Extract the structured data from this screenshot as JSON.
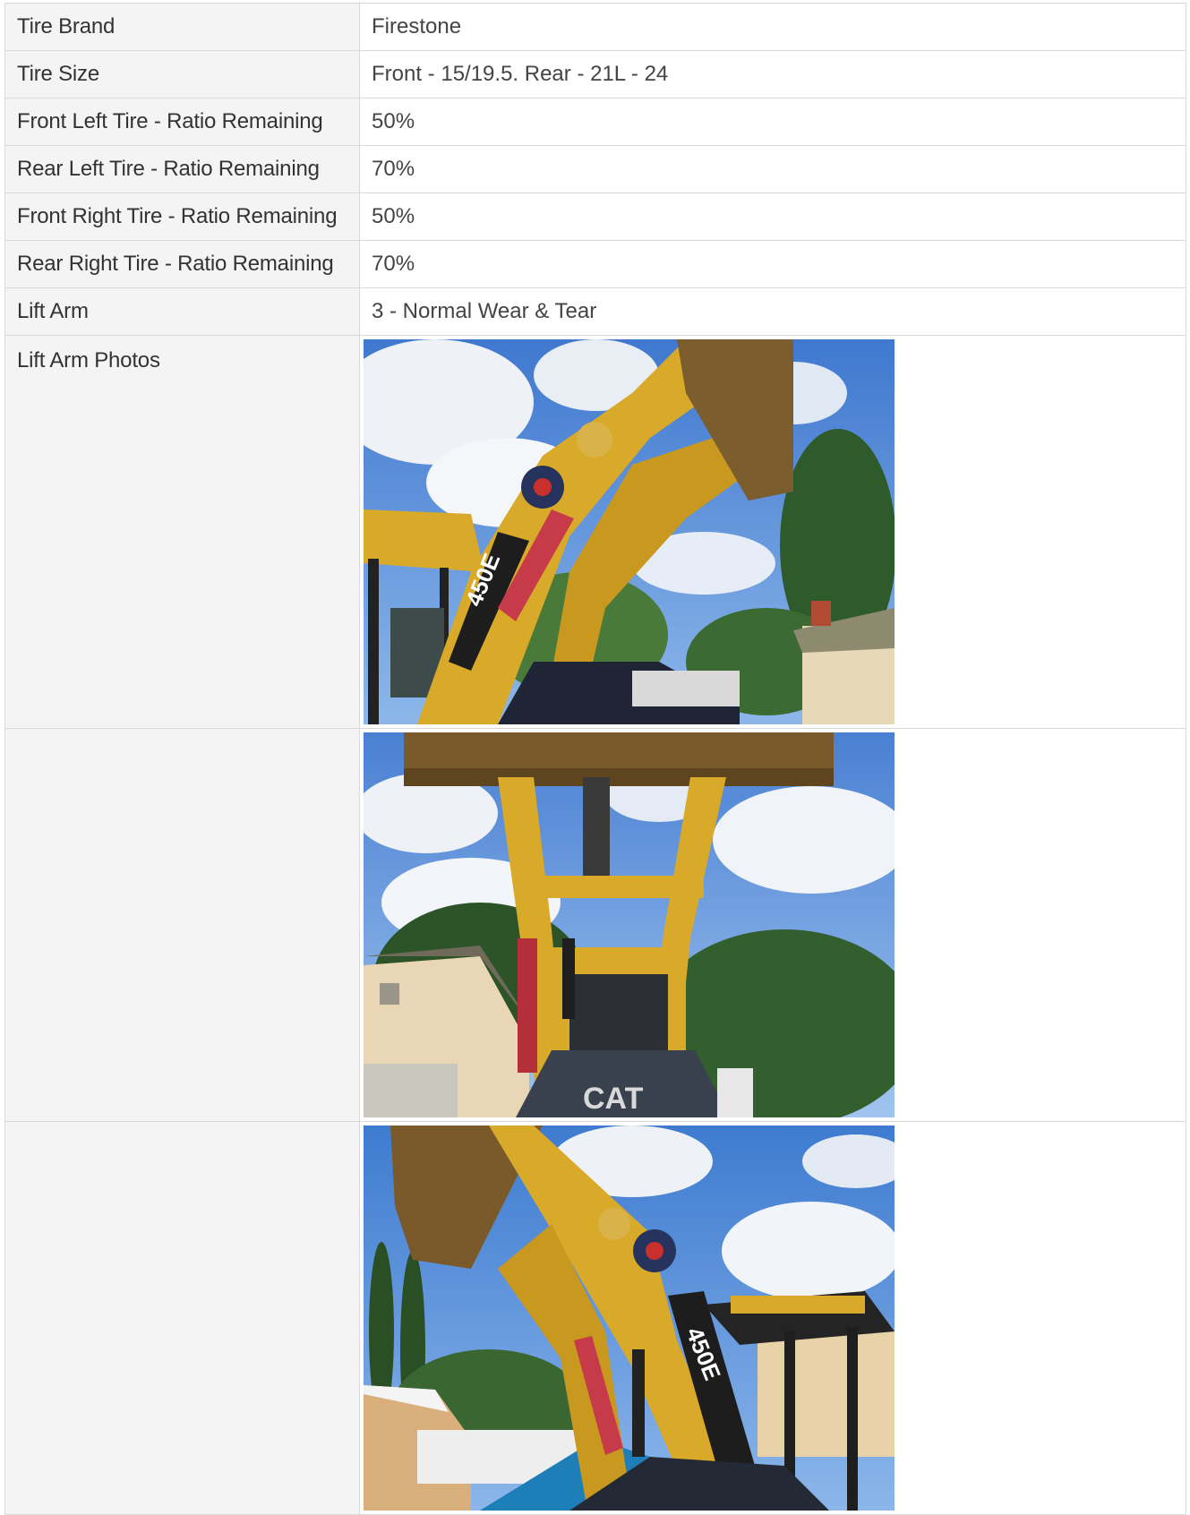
{
  "rows": [
    {
      "label": "Tire Brand",
      "value": "Firestone"
    },
    {
      "label": "Tire Size",
      "value": "Front - 15/19.5. Rear - 21L - 24"
    },
    {
      "label": "Front Left Tire - Ratio Remaining",
      "value": "50%"
    },
    {
      "label": "Rear Left Tire - Ratio Remaining",
      "value": "70%"
    },
    {
      "label": "Front Right Tire - Ratio Remaining",
      "value": "50%"
    },
    {
      "label": "Rear Right Tire - Ratio Remaining",
      "value": "70%"
    },
    {
      "label": "Lift Arm",
      "value": "3 - Normal Wear & Tear"
    }
  ],
  "photos": {
    "label": "Lift Arm Photos",
    "items": [
      {
        "description_icon": "loader-lift-arm-photo",
        "model_text": "450E"
      },
      {
        "description_icon": "loader-front-bucket-photo",
        "model_text": "CAT"
      },
      {
        "description_icon": "loader-side-arm-photo",
        "model_text": "450E"
      }
    ]
  },
  "colors": {
    "label_bg": "#f4f4f4",
    "border": "#d9d9d9",
    "machine_yellow": "#d9a929",
    "sky": "#5b8fd6"
  }
}
